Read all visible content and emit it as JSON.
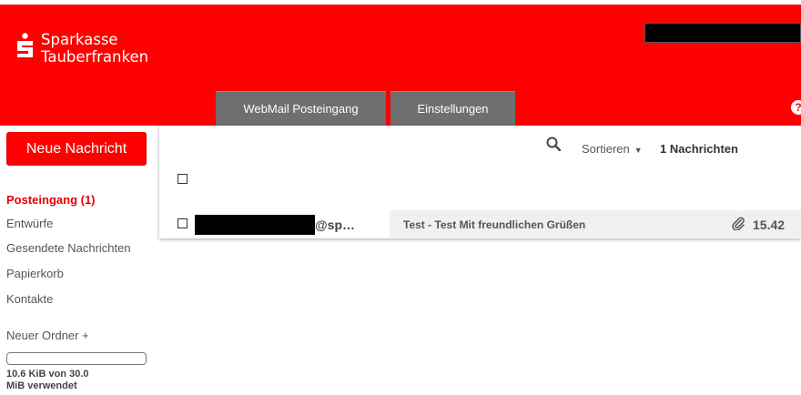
{
  "header": {
    "brand_line1": "Sparkasse",
    "brand_line2": "Tauberfranken",
    "tabs": [
      {
        "label": "WebMail Posteingang"
      },
      {
        "label": "Einstellungen"
      }
    ],
    "help_label": "?"
  },
  "sidebar": {
    "new_message_label": "Neue Nachricht",
    "items": [
      {
        "label": "Posteingang (1)"
      },
      {
        "label": "Entwürfe"
      },
      {
        "label": "Gesendete Nachrichten"
      },
      {
        "label": "Papierkorb"
      },
      {
        "label": "Kontakte"
      }
    ],
    "new_folder_label": "Neuer Ordner +",
    "quota": {
      "text_line1": "10.6 KiB von 30.0",
      "text_line2": "MiB verwendet",
      "fraction": 0.00035
    }
  },
  "toolbar": {
    "sort_label": "Sortieren",
    "count_label": "1 Nachrichten"
  },
  "messages": [
    {
      "sender_suffix": "@sp…",
      "subject": "Test - Test Mit freundlichen Grüßen",
      "time": "15.42"
    }
  ],
  "colors": {
    "brand_red": "#ff0000",
    "tab_gray": "#6f6f6f"
  },
  "icons": [
    "sparkasse-logo-icon",
    "search-icon",
    "caret-down-icon",
    "paperclip-icon",
    "help-icon",
    "checkbox-icon"
  ]
}
